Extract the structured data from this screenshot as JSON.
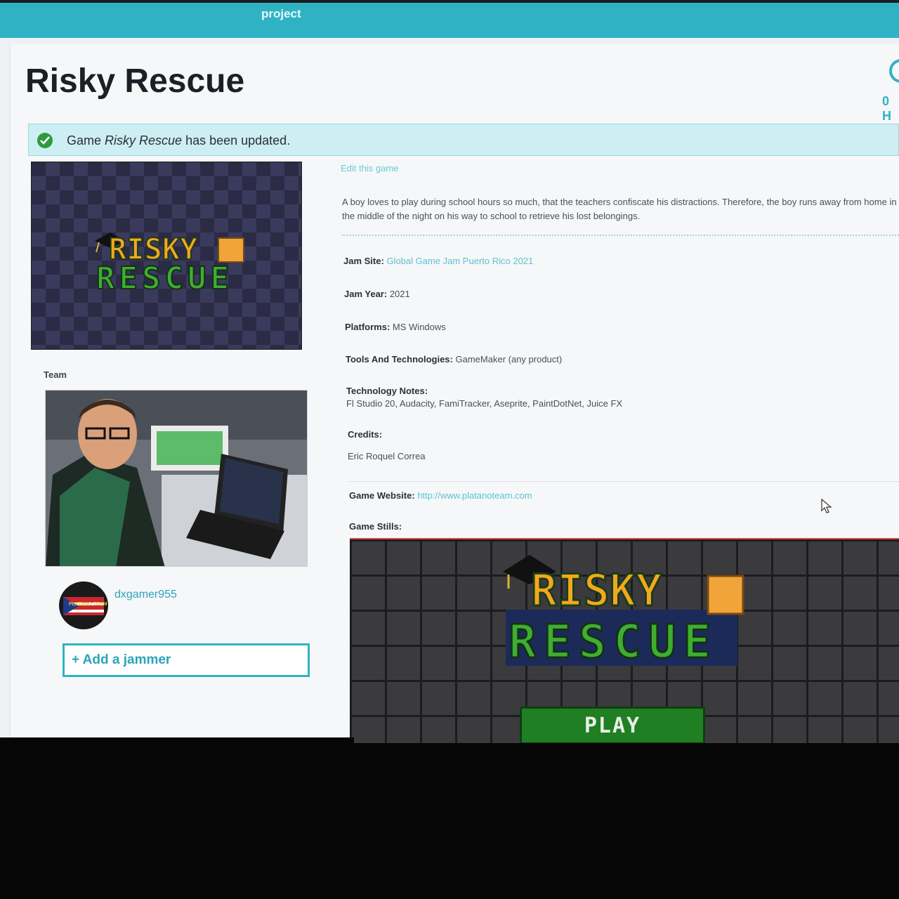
{
  "nav": {
    "label": "project"
  },
  "page": {
    "title": "Risky Rescue",
    "counter": "0 H"
  },
  "alert": {
    "prefix": "Game ",
    "game_name": "Risky Rescue",
    "suffix": " has been updated."
  },
  "cover": {
    "logo_line1": "RISKY",
    "logo_line2": "RESCUE"
  },
  "team": {
    "label": "Team",
    "member": "dxgamer955",
    "avatar_text": "PLATANO TEAM",
    "add_button": "+ Add a jammer"
  },
  "details": {
    "edit_link": "Edit this game",
    "description": "A boy loves to play during school hours so much, that the teachers confiscate his distractions. Therefore, the boy runs away from home in the middle of the night on his way to school to retrieve his lost belongings.",
    "jam_site_label": "Jam Site:",
    "jam_site_value": "Global Game Jam Puerto Rico 2021",
    "jam_year_label": "Jam Year:",
    "jam_year_value": "2021",
    "platforms_label": "Platforms:",
    "platforms_value": "MS Windows",
    "tools_label": "Tools And Technologies:",
    "tools_value": "GameMaker (any product)",
    "tech_notes_label": "Technology Notes:",
    "tech_notes_value": "Fl Studio 20, Audacity, FamiTracker, Aseprite, PaintDotNet, Juice FX",
    "credits_label": "Credits:",
    "credits_value": "Eric Roquel Correa",
    "website_label": "Game Website:",
    "website_value": "http://www.platanoteam.com",
    "stills_label": "Game Stills:"
  },
  "still": {
    "logo_line1": "RISKY",
    "logo_line2": "RESCUE",
    "play_label": "PLAY"
  },
  "colors": {
    "accent": "#2fb3c4",
    "success": "#2f9b3c",
    "play_green": "#1f7f22"
  }
}
